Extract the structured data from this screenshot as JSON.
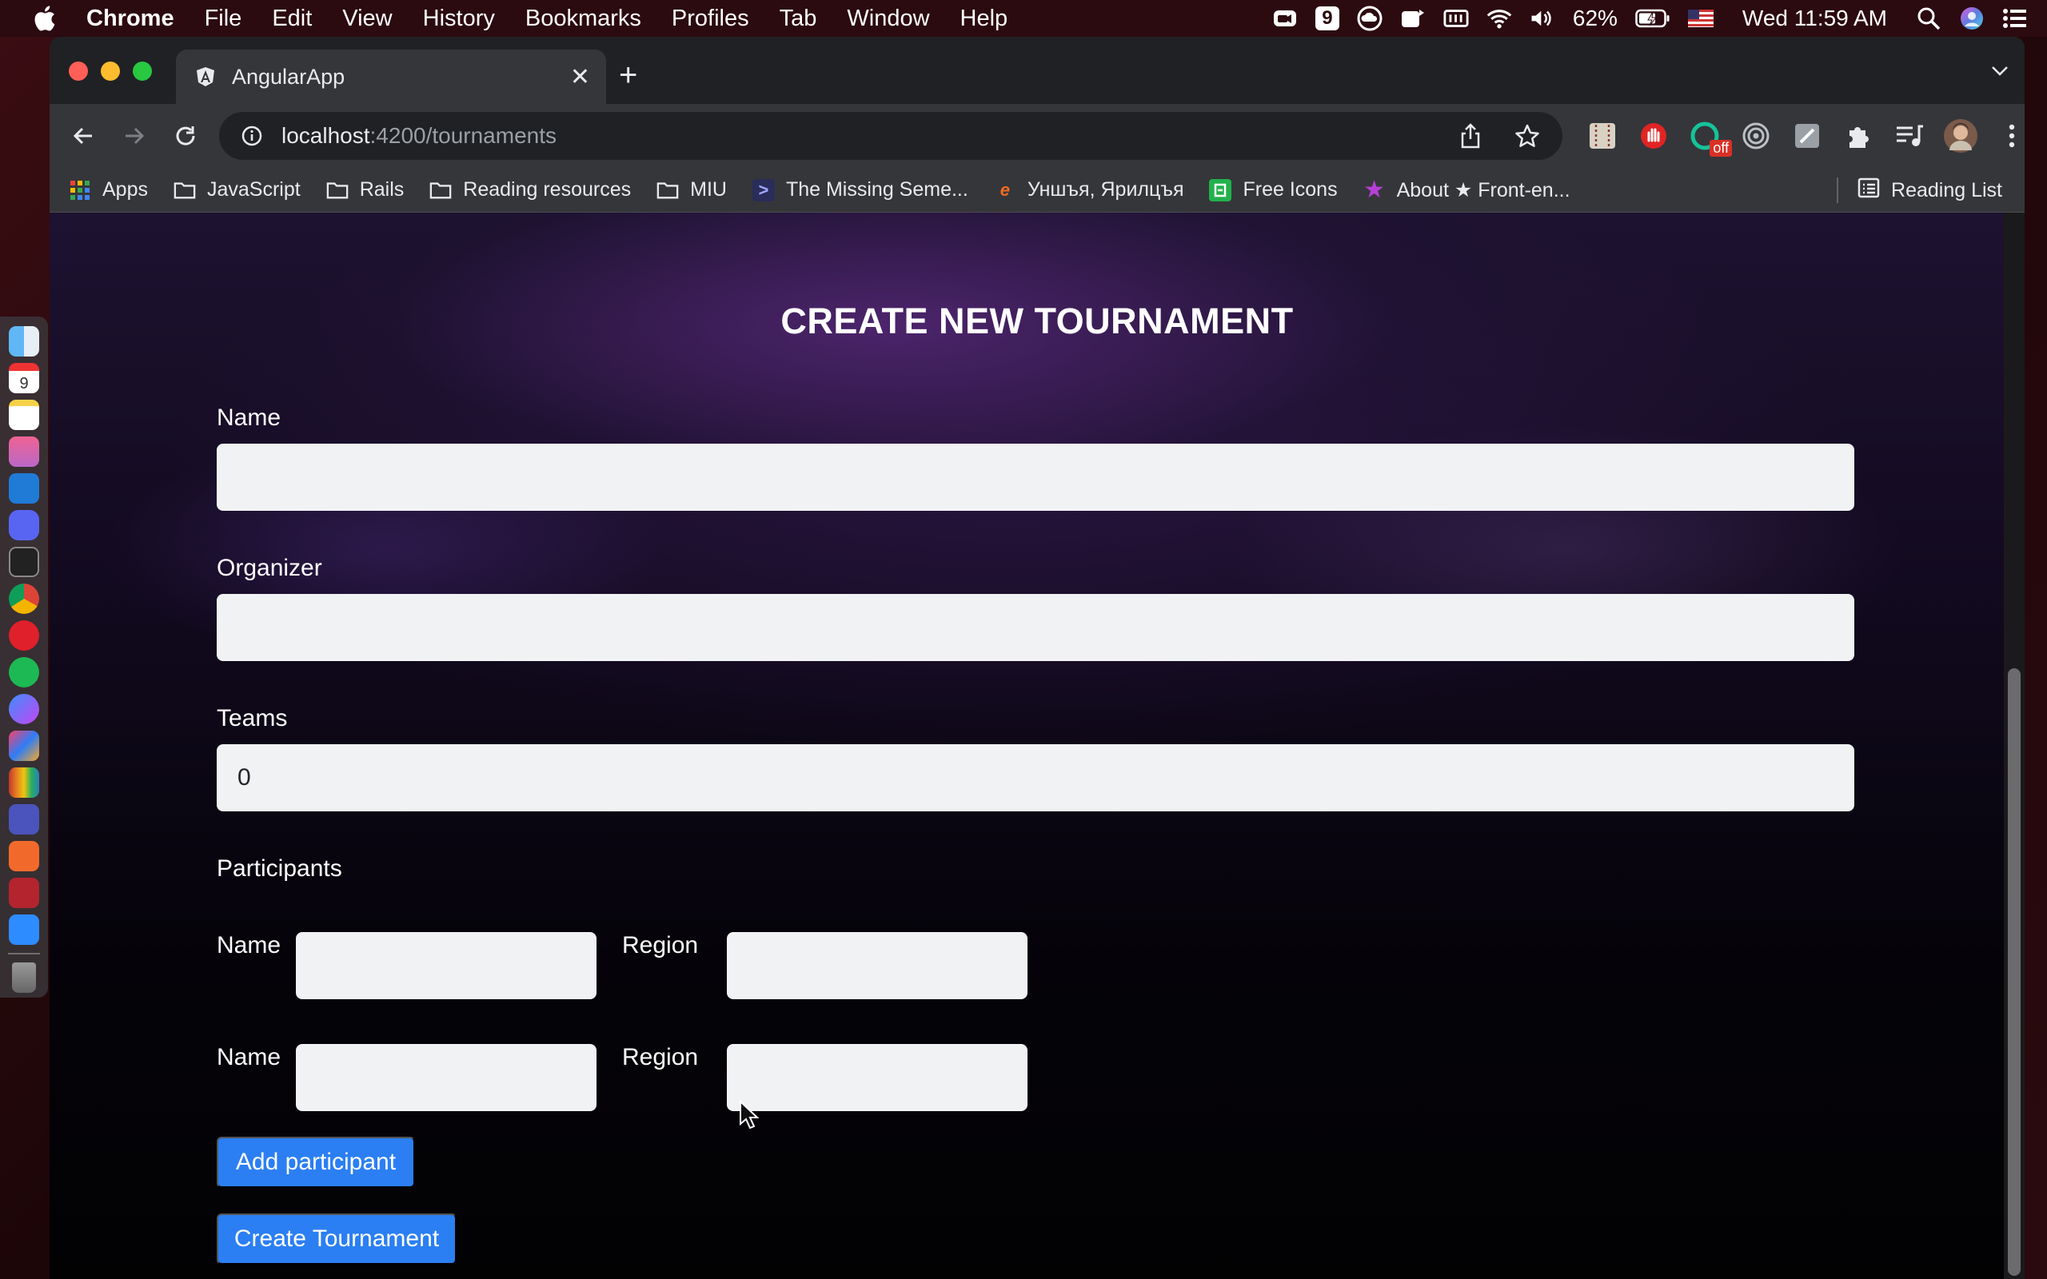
{
  "menubar": {
    "app_name": "Chrome",
    "items": [
      "File",
      "Edit",
      "View",
      "History",
      "Bookmarks",
      "Profiles",
      "Tab",
      "Window",
      "Help"
    ],
    "status": {
      "calendar_badge": "9",
      "battery": "62%",
      "clock": "Wed 11:59 AM"
    }
  },
  "browser": {
    "tab": {
      "title": "AngularApp"
    },
    "omnibox": {
      "host": "localhost",
      "path": ":4200/tournaments"
    },
    "extension_badge": "off",
    "bookmarks": [
      {
        "label": "Apps",
        "icon": "apps-grid-icon"
      },
      {
        "label": "JavaScript",
        "icon": "folder-icon"
      },
      {
        "label": "Rails",
        "icon": "folder-icon"
      },
      {
        "label": "Reading resources",
        "icon": "folder-icon"
      },
      {
        "label": "MIU",
        "icon": "folder-icon"
      },
      {
        "label": "The Missing Seme...",
        "icon": "missing-semester-icon"
      },
      {
        "label": "Уншъя, Ярилцъя",
        "icon": "e-icon"
      },
      {
        "label": "Free Icons",
        "icon": "free-icons-icon"
      },
      {
        "label": "About ★ Front-en...",
        "icon": "star-icon"
      }
    ],
    "reading_list": "Reading List"
  },
  "form": {
    "title": "CREATE NEW TOURNAMENT",
    "name_label": "Name",
    "name_value": "",
    "organizer_label": "Organizer",
    "organizer_value": "",
    "teams_label": "Teams",
    "teams_value": "0",
    "participants_label": "Participants",
    "participants": [
      {
        "name_label": "Name",
        "name_value": "",
        "region_label": "Region",
        "region_value": ""
      },
      {
        "name_label": "Name",
        "name_value": "",
        "region_label": "Region",
        "region_value": ""
      }
    ],
    "add_participant_label": "Add participant",
    "create_label": "Create Tournament"
  },
  "colors": {
    "accent_button": "#2b7ff3",
    "input_background": "#f1f2f4",
    "chrome_toolbar": "#35363a"
  }
}
